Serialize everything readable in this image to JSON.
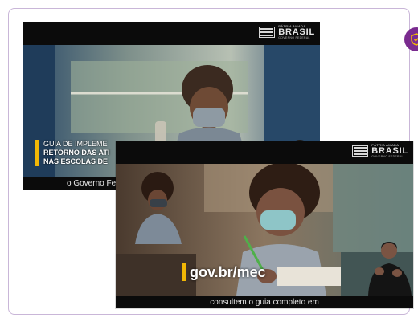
{
  "icons": {
    "badge": "shield-icon",
    "brand_logo": "brand-flag-icon"
  },
  "colors": {
    "border": "#c9b6d8",
    "badge": "#7a2b8f",
    "accent_bar": "#f2b705",
    "black_bar": "#0b0b0b"
  },
  "frame1": {
    "brand": {
      "line1": "PÁTRIA AMADA",
      "line2": "BRASIL",
      "line3": "GOVERNO FEDERAL"
    },
    "guide_lines": [
      "GUIA DE IMPLEME",
      "RETORNO DAS ATI",
      "NAS ESCOLAS DE"
    ],
    "caption": "o Governo Fe"
  },
  "frame2": {
    "brand": {
      "line1": "PÁTRIA AMADA",
      "line2": "BRASIL",
      "line3": "GOVERNO FEDERAL"
    },
    "url": "gov.br/mec",
    "caption": "consultem o guia completo em"
  }
}
